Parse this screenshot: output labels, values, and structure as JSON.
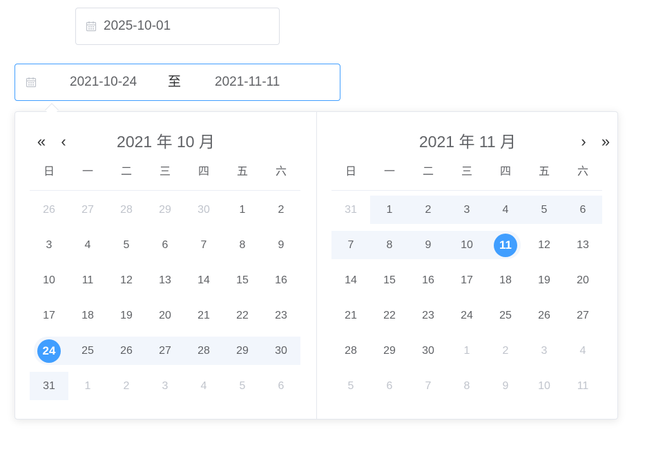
{
  "single_picker": {
    "value": "2025-10-01"
  },
  "range_picker": {
    "start": "2021-10-24",
    "separator": "至",
    "end": "2021-11-11"
  },
  "colors": {
    "accent": "#409eff",
    "range_bg": "#f2f6fc",
    "muted": "#c0c4cc",
    "text": "#606266"
  },
  "nav": {
    "prev_year": "«",
    "prev_month": "‹",
    "next_month": "›",
    "next_year": "»"
  },
  "weekdays": [
    "日",
    "一",
    "二",
    "三",
    "四",
    "五",
    "六"
  ],
  "months": [
    {
      "title": "2021 年 10 月",
      "weeks": [
        [
          {
            "d": "26",
            "m": 1
          },
          {
            "d": "27",
            "m": 1
          },
          {
            "d": "28",
            "m": 1
          },
          {
            "d": "29",
            "m": 1
          },
          {
            "d": "30",
            "m": 1
          },
          {
            "d": "1"
          },
          {
            "d": "2"
          }
        ],
        [
          {
            "d": "3"
          },
          {
            "d": "4"
          },
          {
            "d": "5"
          },
          {
            "d": "6"
          },
          {
            "d": "7"
          },
          {
            "d": "8"
          },
          {
            "d": "9"
          }
        ],
        [
          {
            "d": "10"
          },
          {
            "d": "11"
          },
          {
            "d": "12"
          },
          {
            "d": "13"
          },
          {
            "d": "14"
          },
          {
            "d": "15"
          },
          {
            "d": "16"
          }
        ],
        [
          {
            "d": "17"
          },
          {
            "d": "18"
          },
          {
            "d": "19"
          },
          {
            "d": "20"
          },
          {
            "d": "21"
          },
          {
            "d": "22"
          },
          {
            "d": "23"
          }
        ],
        [
          {
            "d": "24",
            "r": 1,
            "s": 1,
            "st": 1
          },
          {
            "d": "25",
            "r": 1
          },
          {
            "d": "26",
            "r": 1
          },
          {
            "d": "27",
            "r": 1
          },
          {
            "d": "28",
            "r": 1
          },
          {
            "d": "29",
            "r": 1
          },
          {
            "d": "30",
            "r": 1
          }
        ],
        [
          {
            "d": "31",
            "r": 1
          },
          {
            "d": "1",
            "m": 1
          },
          {
            "d": "2",
            "m": 1
          },
          {
            "d": "3",
            "m": 1
          },
          {
            "d": "4",
            "m": 1
          },
          {
            "d": "5",
            "m": 1
          },
          {
            "d": "6",
            "m": 1
          }
        ]
      ]
    },
    {
      "title": "2021 年 11 月",
      "weeks": [
        [
          {
            "d": "31",
            "m": 1
          },
          {
            "d": "1",
            "r": 1
          },
          {
            "d": "2",
            "r": 1
          },
          {
            "d": "3",
            "r": 1
          },
          {
            "d": "4",
            "r": 1
          },
          {
            "d": "5",
            "r": 1
          },
          {
            "d": "6",
            "r": 1
          }
        ],
        [
          {
            "d": "7",
            "r": 1
          },
          {
            "d": "8",
            "r": 1
          },
          {
            "d": "9",
            "r": 1
          },
          {
            "d": "10",
            "r": 1
          },
          {
            "d": "11",
            "r": 1,
            "s": 1,
            "en": 1
          },
          {
            "d": "12"
          },
          {
            "d": "13"
          }
        ],
        [
          {
            "d": "14"
          },
          {
            "d": "15"
          },
          {
            "d": "16"
          },
          {
            "d": "17"
          },
          {
            "d": "18"
          },
          {
            "d": "19"
          },
          {
            "d": "20"
          }
        ],
        [
          {
            "d": "21"
          },
          {
            "d": "22"
          },
          {
            "d": "23"
          },
          {
            "d": "24"
          },
          {
            "d": "25"
          },
          {
            "d": "26"
          },
          {
            "d": "27"
          }
        ],
        [
          {
            "d": "28"
          },
          {
            "d": "29"
          },
          {
            "d": "30"
          },
          {
            "d": "1",
            "m": 1
          },
          {
            "d": "2",
            "m": 1
          },
          {
            "d": "3",
            "m": 1
          },
          {
            "d": "4",
            "m": 1
          }
        ],
        [
          {
            "d": "5",
            "m": 1
          },
          {
            "d": "6",
            "m": 1
          },
          {
            "d": "7",
            "m": 1
          },
          {
            "d": "8",
            "m": 1
          },
          {
            "d": "9",
            "m": 1
          },
          {
            "d": "10",
            "m": 1
          },
          {
            "d": "11",
            "m": 1
          }
        ]
      ]
    }
  ]
}
